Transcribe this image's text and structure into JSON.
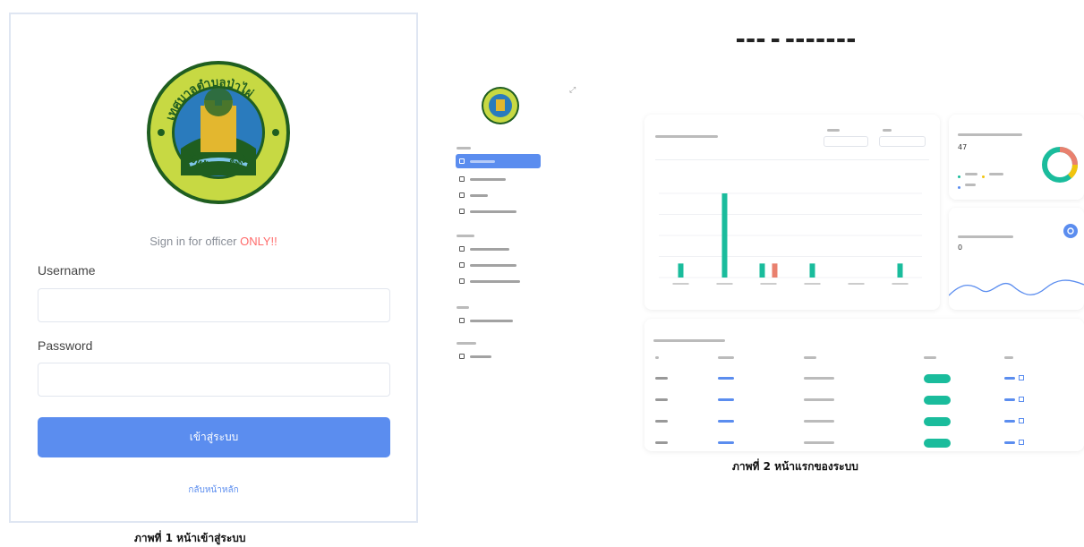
{
  "login": {
    "sign_in_prefix": "Sign in for officer ",
    "sign_in_emphasis": "ONLY!!",
    "username_label": "Username",
    "username_value": "",
    "password_label": "Password",
    "password_value": "",
    "submit_label": "เข้าสู่ระบบ",
    "back_link": "กลับหน้าหลัก",
    "caption": "ภาพที่ 1 หน้าเข้าสู่ระบบ"
  },
  "dashboard": {
    "caption": "ภาพที่ 2 หน้าแรกของระบบ",
    "donut_value": "47",
    "spark_value": "0",
    "colors": {
      "accent": "#5b8def",
      "teal": "#1abc9c",
      "red": "#e9806e",
      "yellow": "#f1c40f"
    }
  },
  "chart_data": {
    "type": "bar",
    "series": [
      {
        "values": [
          1,
          6,
          1,
          1,
          0,
          1
        ]
      },
      {
        "values": [
          0,
          0,
          1,
          0,
          0,
          0
        ]
      }
    ],
    "ylim": [
      0,
      6
    ]
  }
}
